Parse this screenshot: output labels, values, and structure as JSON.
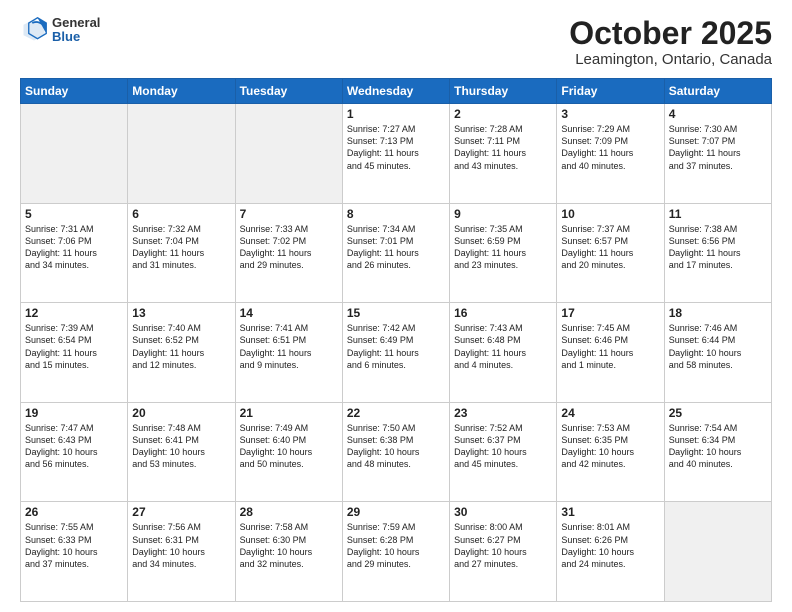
{
  "header": {
    "logo": {
      "general": "General",
      "blue": "Blue"
    },
    "title": "October 2025",
    "location": "Leamington, Ontario, Canada"
  },
  "weekdays": [
    "Sunday",
    "Monday",
    "Tuesday",
    "Wednesday",
    "Thursday",
    "Friday",
    "Saturday"
  ],
  "weeks": [
    [
      {
        "day": "",
        "info": ""
      },
      {
        "day": "",
        "info": ""
      },
      {
        "day": "",
        "info": ""
      },
      {
        "day": "1",
        "info": "Sunrise: 7:27 AM\nSunset: 7:13 PM\nDaylight: 11 hours\nand 45 minutes."
      },
      {
        "day": "2",
        "info": "Sunrise: 7:28 AM\nSunset: 7:11 PM\nDaylight: 11 hours\nand 43 minutes."
      },
      {
        "day": "3",
        "info": "Sunrise: 7:29 AM\nSunset: 7:09 PM\nDaylight: 11 hours\nand 40 minutes."
      },
      {
        "day": "4",
        "info": "Sunrise: 7:30 AM\nSunset: 7:07 PM\nDaylight: 11 hours\nand 37 minutes."
      }
    ],
    [
      {
        "day": "5",
        "info": "Sunrise: 7:31 AM\nSunset: 7:06 PM\nDaylight: 11 hours\nand 34 minutes."
      },
      {
        "day": "6",
        "info": "Sunrise: 7:32 AM\nSunset: 7:04 PM\nDaylight: 11 hours\nand 31 minutes."
      },
      {
        "day": "7",
        "info": "Sunrise: 7:33 AM\nSunset: 7:02 PM\nDaylight: 11 hours\nand 29 minutes."
      },
      {
        "day": "8",
        "info": "Sunrise: 7:34 AM\nSunset: 7:01 PM\nDaylight: 11 hours\nand 26 minutes."
      },
      {
        "day": "9",
        "info": "Sunrise: 7:35 AM\nSunset: 6:59 PM\nDaylight: 11 hours\nand 23 minutes."
      },
      {
        "day": "10",
        "info": "Sunrise: 7:37 AM\nSunset: 6:57 PM\nDaylight: 11 hours\nand 20 minutes."
      },
      {
        "day": "11",
        "info": "Sunrise: 7:38 AM\nSunset: 6:56 PM\nDaylight: 11 hours\nand 17 minutes."
      }
    ],
    [
      {
        "day": "12",
        "info": "Sunrise: 7:39 AM\nSunset: 6:54 PM\nDaylight: 11 hours\nand 15 minutes."
      },
      {
        "day": "13",
        "info": "Sunrise: 7:40 AM\nSunset: 6:52 PM\nDaylight: 11 hours\nand 12 minutes."
      },
      {
        "day": "14",
        "info": "Sunrise: 7:41 AM\nSunset: 6:51 PM\nDaylight: 11 hours\nand 9 minutes."
      },
      {
        "day": "15",
        "info": "Sunrise: 7:42 AM\nSunset: 6:49 PM\nDaylight: 11 hours\nand 6 minutes."
      },
      {
        "day": "16",
        "info": "Sunrise: 7:43 AM\nSunset: 6:48 PM\nDaylight: 11 hours\nand 4 minutes."
      },
      {
        "day": "17",
        "info": "Sunrise: 7:45 AM\nSunset: 6:46 PM\nDaylight: 11 hours\nand 1 minute."
      },
      {
        "day": "18",
        "info": "Sunrise: 7:46 AM\nSunset: 6:44 PM\nDaylight: 10 hours\nand 58 minutes."
      }
    ],
    [
      {
        "day": "19",
        "info": "Sunrise: 7:47 AM\nSunset: 6:43 PM\nDaylight: 10 hours\nand 56 minutes."
      },
      {
        "day": "20",
        "info": "Sunrise: 7:48 AM\nSunset: 6:41 PM\nDaylight: 10 hours\nand 53 minutes."
      },
      {
        "day": "21",
        "info": "Sunrise: 7:49 AM\nSunset: 6:40 PM\nDaylight: 10 hours\nand 50 minutes."
      },
      {
        "day": "22",
        "info": "Sunrise: 7:50 AM\nSunset: 6:38 PM\nDaylight: 10 hours\nand 48 minutes."
      },
      {
        "day": "23",
        "info": "Sunrise: 7:52 AM\nSunset: 6:37 PM\nDaylight: 10 hours\nand 45 minutes."
      },
      {
        "day": "24",
        "info": "Sunrise: 7:53 AM\nSunset: 6:35 PM\nDaylight: 10 hours\nand 42 minutes."
      },
      {
        "day": "25",
        "info": "Sunrise: 7:54 AM\nSunset: 6:34 PM\nDaylight: 10 hours\nand 40 minutes."
      }
    ],
    [
      {
        "day": "26",
        "info": "Sunrise: 7:55 AM\nSunset: 6:33 PM\nDaylight: 10 hours\nand 37 minutes."
      },
      {
        "day": "27",
        "info": "Sunrise: 7:56 AM\nSunset: 6:31 PM\nDaylight: 10 hours\nand 34 minutes."
      },
      {
        "day": "28",
        "info": "Sunrise: 7:58 AM\nSunset: 6:30 PM\nDaylight: 10 hours\nand 32 minutes."
      },
      {
        "day": "29",
        "info": "Sunrise: 7:59 AM\nSunset: 6:28 PM\nDaylight: 10 hours\nand 29 minutes."
      },
      {
        "day": "30",
        "info": "Sunrise: 8:00 AM\nSunset: 6:27 PM\nDaylight: 10 hours\nand 27 minutes."
      },
      {
        "day": "31",
        "info": "Sunrise: 8:01 AM\nSunset: 6:26 PM\nDaylight: 10 hours\nand 24 minutes."
      },
      {
        "day": "",
        "info": ""
      }
    ]
  ]
}
